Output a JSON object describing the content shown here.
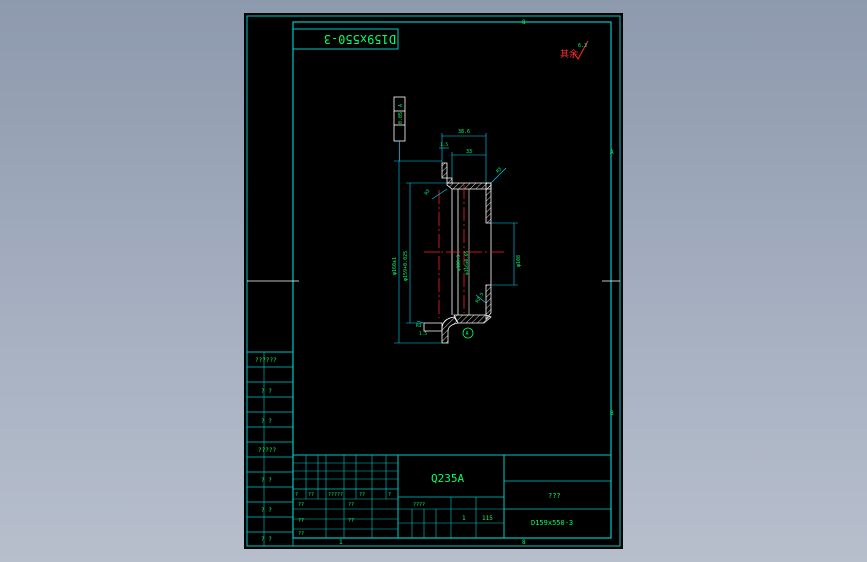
{
  "colors": {
    "frame": "#00c8c8",
    "text": "#00ff66",
    "dim": "#00d8ff",
    "center": "#ff2020",
    "hatch": "#ffffff",
    "roughness_mark": "#ff2a2a"
  },
  "drawing_code_mirrored": "D159x550-3",
  "roughness_mark": {
    "text": "其余",
    "value": "6.3"
  },
  "frame_markers": {
    "top_mark": "8",
    "bottom_mark": "8",
    "right_mark_a": "A",
    "right_mark_b": "B",
    "bottom_tick": "1"
  },
  "tolerance_box": {
    "value": "0.05",
    "datum": "A"
  },
  "dimensions": {
    "top_outer": "38.6",
    "top_inner": "33",
    "left_gap": "1.5",
    "corner_top": "R3",
    "corner_right": "R3",
    "left_overall": "φ160±1",
    "left_inner": "φ159+0.025",
    "center_left": "φ108.3",
    "center_right": "φ116±0.05",
    "right_bore": "φ108",
    "bottom_radius_left": "R3",
    "bottom_radius_right": "R2.5",
    "bottom_left": "1.5",
    "datum_label": "A"
  },
  "left_column": {
    "labels": [
      "??????",
      "? ?",
      "? ?",
      "?????",
      "? ?",
      "? ?",
      "? ?"
    ]
  },
  "title_block": {
    "material": "Q235A",
    "part_name": "???",
    "drawing_number": "D159x550-3",
    "sign_row": [
      "?",
      "??",
      "?????",
      "??",
      "?"
    ],
    "scale_row": [
      "????",
      "1",
      "115"
    ],
    "mid_labels": [
      "??",
      "??"
    ],
    "approval_labels": [
      "??",
      "??",
      "??"
    ]
  }
}
